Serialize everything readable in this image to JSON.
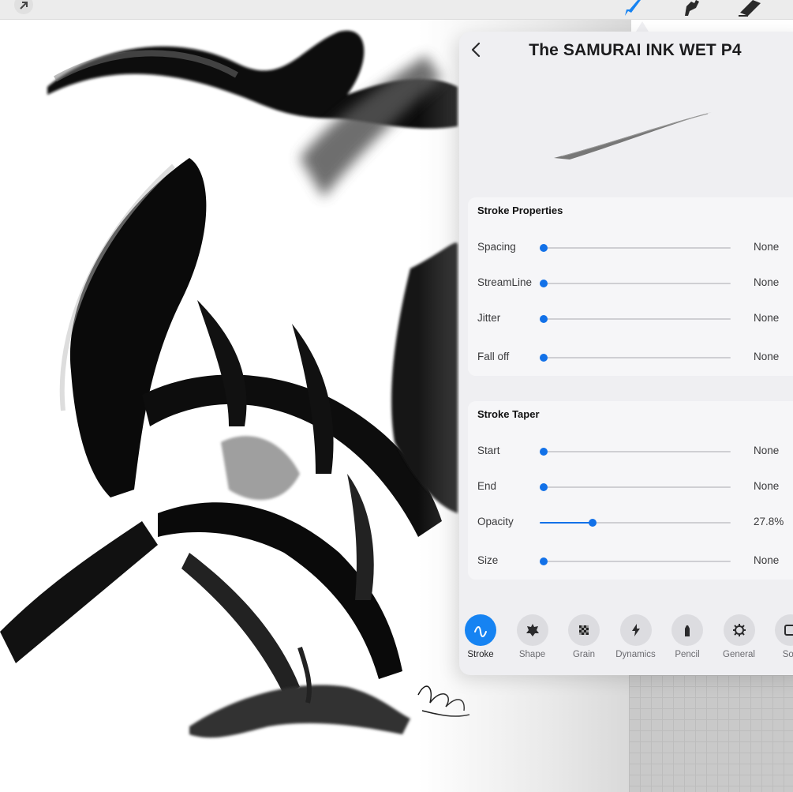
{
  "toolbar": {
    "icons": [
      "actions-arrow-icon",
      "brush-icon",
      "smudge-icon",
      "eraser-icon"
    ],
    "active_tool": "brush",
    "accent": "#1683f2"
  },
  "artwork": {
    "signature": "YPzenR 2016"
  },
  "brush_studio": {
    "title": "The SAMURAI INK WET P4",
    "back_icon": "chevron-left-icon",
    "stroke_properties": {
      "title": "Stroke Properties",
      "rows": [
        {
          "label": "Spacing",
          "value": "None",
          "level": 0.0
        },
        {
          "label": "StreamLine",
          "value": "None",
          "level": 0.0
        },
        {
          "label": "Jitter",
          "value": "None",
          "level": 0.0
        },
        {
          "label": "Fall off",
          "value": "None",
          "level": 0.0
        }
      ]
    },
    "stroke_taper": {
      "title": "Stroke Taper",
      "rows": [
        {
          "label": "Start",
          "value": "None",
          "level": 0.0
        },
        {
          "label": "End",
          "value": "None",
          "level": 0.0
        },
        {
          "label": "Opacity",
          "value": "27.8%",
          "level": 0.278
        },
        {
          "label": "Size",
          "value": "None",
          "level": 0.0
        }
      ]
    },
    "tabs": [
      {
        "label": "Stroke",
        "icon": "stroke-wave-icon",
        "active": true
      },
      {
        "label": "Shape",
        "icon": "shape-blob-icon",
        "active": false
      },
      {
        "label": "Grain",
        "icon": "grain-checker-icon",
        "active": false
      },
      {
        "label": "Dynamics",
        "icon": "lightning-icon",
        "active": false
      },
      {
        "label": "Pencil",
        "icon": "pencil-tip-icon",
        "active": false
      },
      {
        "label": "General",
        "icon": "gear-icon",
        "active": false
      },
      {
        "label": "Sou",
        "icon": "source-icon",
        "active": false
      }
    ]
  }
}
